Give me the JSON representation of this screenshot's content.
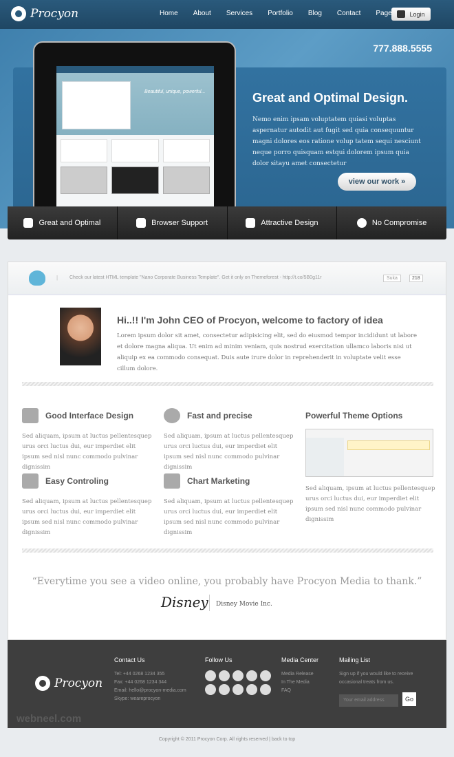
{
  "brand": {
    "name": "Procyon"
  },
  "nav": {
    "items": [
      "Home",
      "About",
      "Services",
      "Portfolio",
      "Blog",
      "Contact",
      "Pages"
    ],
    "login_label": "Login"
  },
  "hero": {
    "phone": "777.888.5555",
    "title": "Great and Optimal Design.",
    "text": "Nemo enim ipsam voluptatem quiasi voluptas aspernatur autodit aut fugit sed quia consequuntur magni dolores eos ratione volup tatem sequi nesciunt neque porro quisquam estqui dolorem ipsum quia dolor sitayu amet consectetur",
    "button": "view our work »",
    "screen_tagline": "Beautiful, unique, powerful..."
  },
  "features_bar": [
    {
      "label": "Great and Optimal",
      "icon": "gear-icon"
    },
    {
      "label": "Browser Support",
      "icon": "envelope-icon"
    },
    {
      "label": "Attractive Design",
      "icon": "image-icon"
    },
    {
      "label": "No Compromise",
      "icon": "globe-icon"
    }
  ],
  "tweet": {
    "text": "Check our latest HTML template \"Nano Corporate Business Template\". Get it only on Themeforest - http://t.co/5B0g11r",
    "like_label": "Suka",
    "like_count": "218"
  },
  "intro": {
    "title": "Hi..!! I'm John CEO of Procyon, welcome to factory of idea",
    "text": "Lorem ipsum dolor sit amet, consectetur adipisicing elit, sed do eiusmod tempor incididunt ut labore et dolore magna aliqua. Ut enim ad minim veniam, quis nostrud exercitation ullamco laboris nisi ut aliquip ex ea commodo consequat. Duis aute irure dolor in reprehenderit in voluptate velit esse cillum dolore."
  },
  "features": [
    {
      "title": "Good Interface Design",
      "icon": "monitor-icon",
      "text": "Sed aliquam, ipsum at luctus pellentesquep urus orci luctus dui, eur imperdiet elit ipsum sed nisl nunc commodo pulvinar dignissim"
    },
    {
      "title": "Fast and precise",
      "icon": "alarm-clock-icon",
      "text": "Sed aliquam, ipsum at luctus pellentesquep urus orci luctus dui, eur imperdiet elit ipsum sed nisl nunc commodo pulvinar dignissim"
    },
    {
      "title": "Easy Controling",
      "icon": "calendar-icon",
      "text": "Sed aliquam, ipsum at luctus pellentesquep urus orci luctus dui, eur imperdiet elit ipsum sed nisl nunc commodo pulvinar dignissim"
    },
    {
      "title": "Chart Marketing",
      "icon": "laptop-icon",
      "text": "Sed aliquam, ipsum at luctus pellentesquep urus orci luctus dui, eur imperdiet elit ipsum sed nisl nunc commodo pulvinar dignissim"
    }
  ],
  "theme_options": {
    "title": "Powerful Theme Options",
    "text": "Sed aliquam, ipsum at luctus pellentesquep urus orci luctus dui, eur imperdiet elit ipsum sed nisl nunc commodo pulvinar dignissim"
  },
  "testimonial": {
    "quote": "“Everytime you see a video online, you probably have Procyon Media to thank.”",
    "brand": "Disney",
    "company": "Disney Movie Inc."
  },
  "footer": {
    "contact": {
      "heading": "Contact Us",
      "lines": [
        "Tel: +44 0268 1234 355",
        "Fax: +44 0268 1234 344",
        "Email: hello@procyon-media.com",
        "Skype: weareprocyon"
      ]
    },
    "follow": {
      "heading": "Follow Us"
    },
    "media": {
      "heading": "Media Center",
      "links": [
        "Media Release",
        "In The Media",
        "FAQ"
      ]
    },
    "mailing": {
      "heading": "Mailing List",
      "text": "Sign up if you would like to receive occasional treats from us.",
      "placeholder": "Your email address",
      "button": "Go"
    },
    "watermark": "webneel.com"
  },
  "copyright": "Copyright © 2011 Procyon Corp. All rights reserved   |   back to top"
}
